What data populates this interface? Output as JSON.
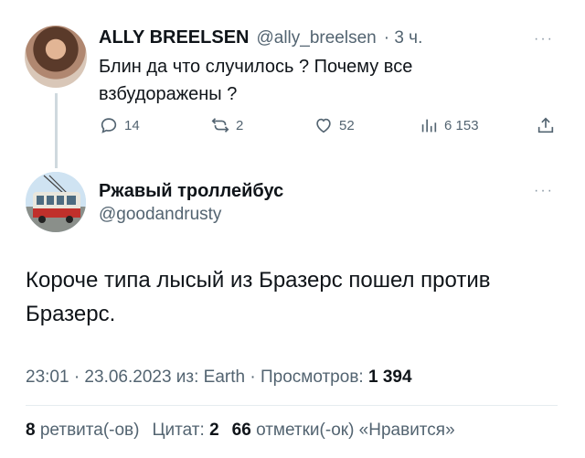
{
  "tweet1": {
    "author_name": "ALLY BREELSEN",
    "handle": "@ally_breelsen",
    "time": "· 3 ч.",
    "more": "···",
    "text": "Блин да что случилось ? Почему все взбудоражены ?",
    "actions": {
      "replies": "14",
      "retweets": "2",
      "likes": "52",
      "views": "6 153"
    }
  },
  "tweet2": {
    "author_name": "Ржавый троллейбус",
    "handle": "@goodandrusty",
    "more": "···",
    "text": "Короче типа лысый из Бразерс пошел против Бразерс.",
    "meta_prefix": "23:01 · 23.06.2023 из: Earth · Просмотров:",
    "views_count": "1 394",
    "stats": {
      "retweets_count": "8",
      "retweets_label": "ретвита(-ов)",
      "quotes_label": "Цитат:",
      "quotes_count": "2",
      "likes_count": "66",
      "likes_label": "отметки(-ок) «Нравится»"
    }
  },
  "colors": {
    "text": "#0f1419",
    "secondary": "#536471",
    "divider": "#e6ecf0"
  }
}
